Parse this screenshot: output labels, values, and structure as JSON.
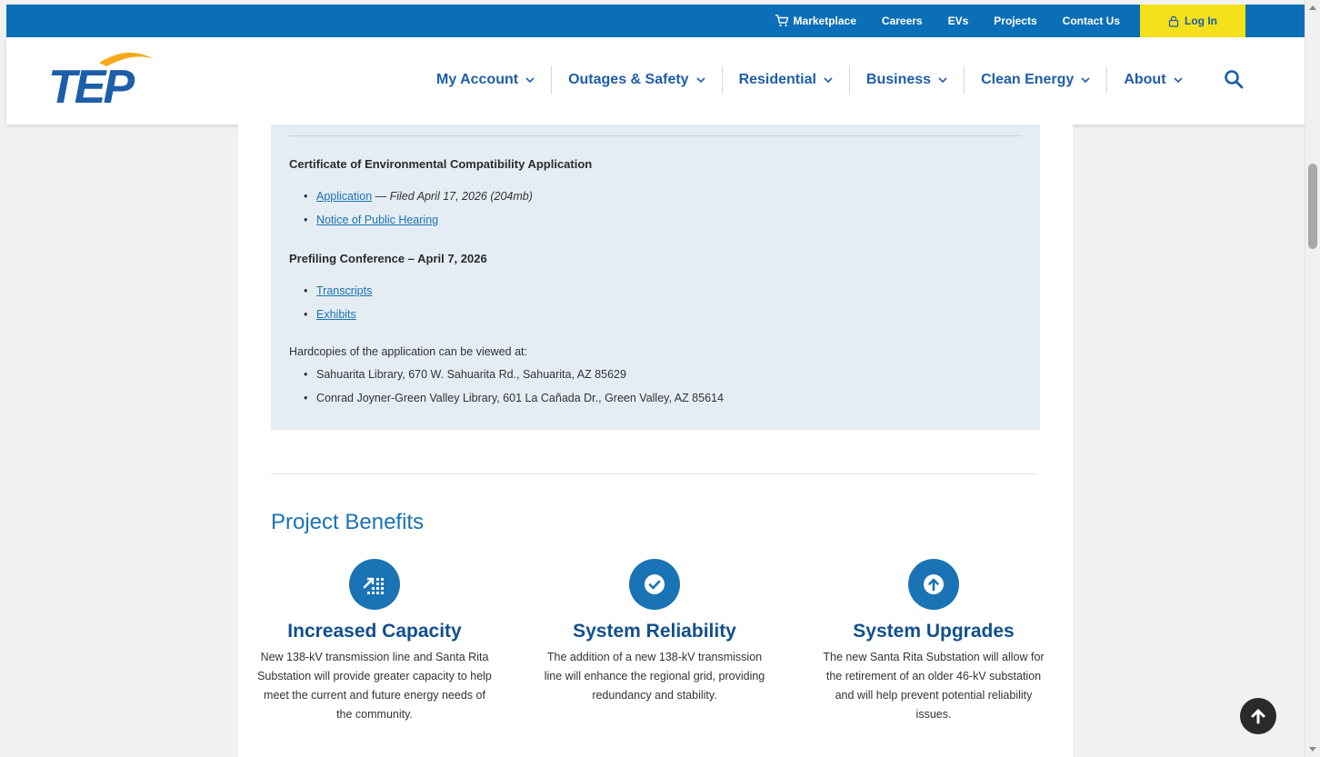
{
  "utility_bar": {
    "links": [
      {
        "label": "Marketplace",
        "icon": "cart-icon"
      },
      {
        "label": "Careers"
      },
      {
        "label": "EVs"
      },
      {
        "label": "Projects"
      },
      {
        "label": "Contact Us"
      }
    ],
    "login_label": "Log In",
    "color": "#0b6fb7",
    "login_color": "#f5e11a"
  },
  "header": {
    "logo_text": "TEP",
    "nav": [
      {
        "label": "My Account"
      },
      {
        "label": "Outages & Safety"
      },
      {
        "label": "Residential"
      },
      {
        "label": "Business"
      },
      {
        "label": "Clean Energy"
      },
      {
        "label": "About"
      }
    ]
  },
  "documents": {
    "cec_heading": "Certificate of Environmental Compatibility Application",
    "cec_items": [
      {
        "link": "Application",
        "note": "— Filed April 17, 2026 (204mb)"
      },
      {
        "link": "Notice of Public Hearing"
      }
    ],
    "prefiling_heading": "Prefiling Conference – April 7, 2026",
    "prefiling_items": [
      {
        "link": "Transcripts"
      },
      {
        "link": "Exhibits"
      }
    ],
    "hardcopies_intro": "Hardcopies of the application can be viewed at:",
    "hardcopies_locations": [
      "Sahuarita Library, 670 W. Sahuarita Rd., Sahuarita, AZ 85629",
      "Conrad Joyner-Green Valley Library, 601 La Cañada Dr., Green Valley, AZ 85614"
    ]
  },
  "benefits": {
    "section_title": "Project Benefits",
    "items": [
      {
        "title": "Increased Capacity",
        "icon": "capacity-chart-icon",
        "text": "New 138-kV transmission line and Santa Rita Substation will provide greater capacity to help meet the current and future energy needs of the community."
      },
      {
        "title": "System Reliability",
        "icon": "checkmark-icon",
        "text": "The addition of a new 138-kV transmission line will enhance the regional grid, providing redundancy and stability."
      },
      {
        "title": "System Upgrades",
        "icon": "upgrade-arrow-icon",
        "text": "The new Santa Rita Substation will allow for the retirement of an older 46-kV substation and will help prevent potential reliability issues."
      }
    ]
  },
  "colors": {
    "brand_blue": "#1a73b4",
    "heading_blue": "#124f8e",
    "doc_box_bg": "#e4ecf4"
  }
}
